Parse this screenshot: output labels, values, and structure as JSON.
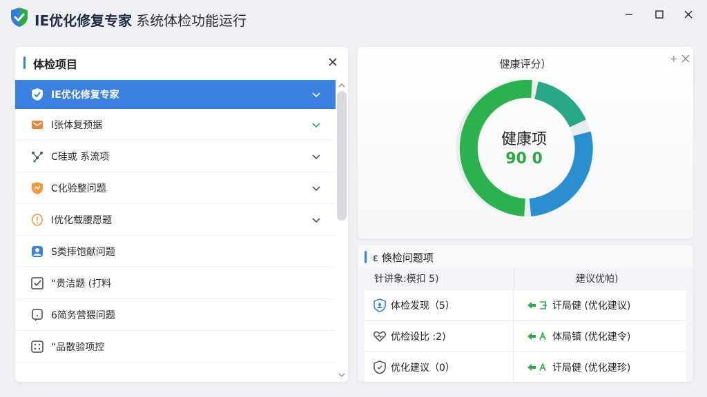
{
  "app": {
    "title": "IE优化修复专家",
    "subtitle": "系统体检功能运行",
    "logo_icon": "shield-check-icon",
    "brand_color": "#2f7de0"
  },
  "window_controls": {
    "minimize_icon": "minimize-icon",
    "maximize_icon": "maximize-icon",
    "close_icon": "close-icon"
  },
  "left_panel": {
    "title": "体检项目",
    "close_icon": "close-icon",
    "items": [
      {
        "label": "IE优化修复专家",
        "icon": "shield-check-icon",
        "active": true,
        "expandable": true
      },
      {
        "label": "I张体复预据",
        "icon": "envelope-icon",
        "active": false,
        "expandable": true
      },
      {
        "label": "C硅或 系流项",
        "icon": "network-icon",
        "active": false,
        "expandable": true
      },
      {
        "label": "C化验整问题",
        "icon": "shield-warning-icon",
        "active": false,
        "expandable": true
      },
      {
        "label": "I优化载腰愿题",
        "icon": "warning-icon",
        "active": false,
        "expandable": true
      },
      {
        "label": "S类摔饱献问题",
        "icon": "user-icon",
        "active": false,
        "expandable": false
      },
      {
        "label": "“贵洁题 (打料",
        "icon": "checkbox-icon",
        "active": false,
        "expandable": false
      },
      {
        "label": "6简务营猥问题",
        "icon": "chat-icon",
        "active": false,
        "expandable": false
      },
      {
        "label": "“品散验项控",
        "icon": "grid-icon",
        "active": false,
        "expandable": false
      }
    ]
  },
  "health": {
    "title": "健康评分）",
    "center_label": "健康项",
    "center_value": "90 0",
    "score": 90,
    "colors": {
      "green": "#2bb24c",
      "teal": "#26a08a",
      "blue": "#2a8fd0"
    }
  },
  "issues": {
    "title": "ε 倏检问题项",
    "col_left": "针讲象:模扣 5)",
    "col_right": "建议优帕)",
    "rows": [
      {
        "left_icon": "shield-person-icon",
        "left": "体检发现（5）",
        "right": "讦局健 (优化建议)"
      },
      {
        "left_icon": "heart-icon",
        "left": "优检设比 :2)",
        "right": "体局镇 (优化建令)"
      },
      {
        "left_icon": "shield-icon",
        "left": "优化建议（0）",
        "right": "讦局健 (优化建珍)"
      }
    ],
    "action_icon": "repair-arrow-icon"
  }
}
